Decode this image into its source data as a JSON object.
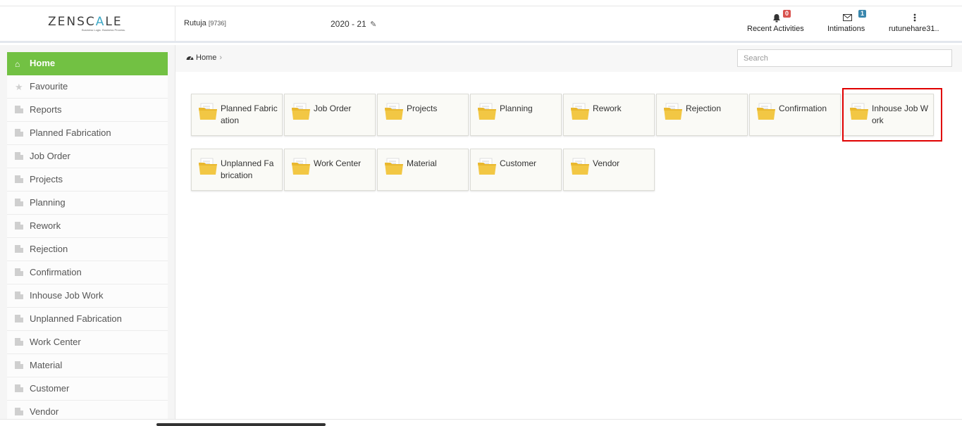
{
  "header": {
    "logo": "ZENSCALE",
    "logo_tagline": "Business Logic. Business Process.",
    "user_name": "Rutuja",
    "user_id": "[9736]",
    "year": "2020 - 21",
    "recent_activities_label": "Recent Activities",
    "recent_activities_count": "0",
    "intimations_label": "Intimations",
    "intimations_count": "1",
    "account_label": "rutunehare31.."
  },
  "sidebar": {
    "items": [
      {
        "label": "Home",
        "icon": "home-icon",
        "active": true
      },
      {
        "label": "Favourite",
        "icon": "star-icon"
      },
      {
        "label": "Reports",
        "icon": "document-icon"
      },
      {
        "label": "Planned Fabrication",
        "icon": "document-icon"
      },
      {
        "label": "Job Order",
        "icon": "document-icon"
      },
      {
        "label": "Projects",
        "icon": "document-icon"
      },
      {
        "label": "Planning",
        "icon": "document-icon"
      },
      {
        "label": "Rework",
        "icon": "document-icon"
      },
      {
        "label": "Rejection",
        "icon": "document-icon"
      },
      {
        "label": "Confirmation",
        "icon": "document-icon"
      },
      {
        "label": "Inhouse Job Work",
        "icon": "document-icon"
      },
      {
        "label": "Unplanned Fabrication",
        "icon": "document-icon"
      },
      {
        "label": "Work Center",
        "icon": "document-icon"
      },
      {
        "label": "Material",
        "icon": "document-icon"
      },
      {
        "label": "Customer",
        "icon": "document-icon"
      },
      {
        "label": "Vendor",
        "icon": "document-icon"
      }
    ]
  },
  "breadcrumb": {
    "home_label": "Home",
    "separator": "›"
  },
  "search": {
    "placeholder": "Search"
  },
  "tiles": [
    {
      "label": "Planned Fabrication",
      "icon": "folder-icon"
    },
    {
      "label": "Job Order",
      "icon": "folder-icon"
    },
    {
      "label": "Projects",
      "icon": "folder-icon"
    },
    {
      "label": "Planning",
      "icon": "folder-icon"
    },
    {
      "label": "Rework",
      "icon": "folder-icon"
    },
    {
      "label": "Rejection",
      "icon": "folder-icon"
    },
    {
      "label": "Confirmation",
      "icon": "folder-icon"
    },
    {
      "label": "Inhouse Job Work",
      "icon": "folder-icon",
      "highlighted": true
    },
    {
      "label": "Unplanned Fabrication",
      "icon": "folder-icon"
    },
    {
      "label": "Work Center",
      "icon": "folder-icon"
    },
    {
      "label": "Material",
      "icon": "folder-icon"
    },
    {
      "label": "Customer",
      "icon": "folder-icon"
    },
    {
      "label": "Vendor",
      "icon": "folder-icon"
    }
  ],
  "colors": {
    "active_menu": "#72c143",
    "highlight_border": "#e00000",
    "folder": "#f2c744",
    "badge_red": "#d9534f",
    "badge_blue": "#3a87ad"
  }
}
